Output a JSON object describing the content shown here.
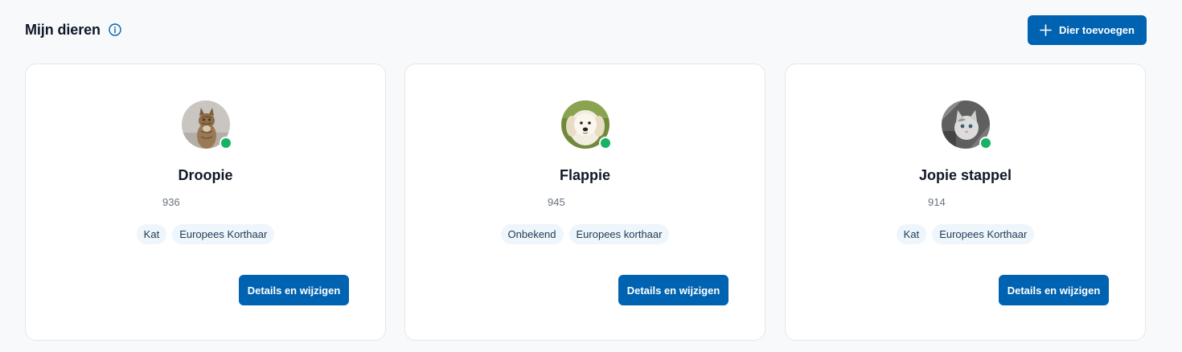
{
  "header": {
    "title": "Mijn dieren",
    "add_button_label": "Dier toevoegen"
  },
  "colors": {
    "primary": "#0063b1",
    "status_online": "#16b364",
    "tag_background": "#eef5fb"
  },
  "pets": [
    {
      "name": "Droopie",
      "id": "936",
      "tags": [
        "Kat",
        "Europees Korthaar"
      ],
      "details_button_label": "Details en wijzigen"
    },
    {
      "name": "Flappie",
      "id": "945",
      "tags": [
        "Onbekend",
        "Europees korthaar"
      ],
      "details_button_label": "Details en wijzigen"
    },
    {
      "name": "Jopie stappel",
      "id": "914",
      "tags": [
        "Kat",
        "Europees Korthaar"
      ],
      "details_button_label": "Details en wijzigen"
    }
  ]
}
